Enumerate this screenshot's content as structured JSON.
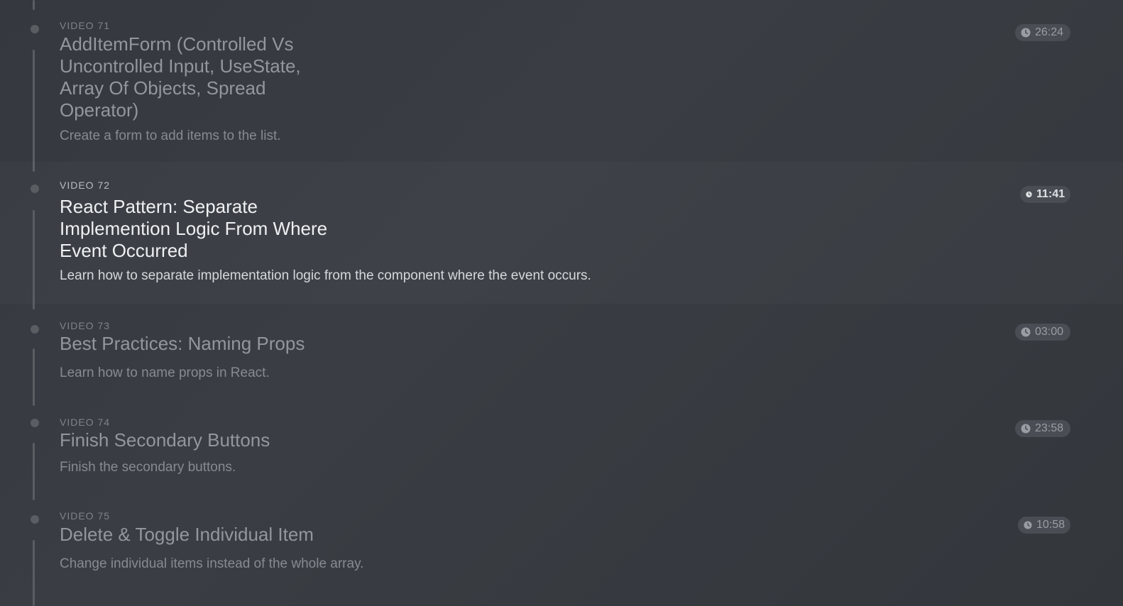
{
  "videos": [
    {
      "label": "VIDEO 71",
      "title": "AddItemForm (Controlled Vs Uncontrolled Input, UseState, Array Of Objects, Spread Operator)",
      "description": "Create a form to add items to the list.",
      "duration": "26:24",
      "active": false
    },
    {
      "label": "VIDEO 72",
      "title": "React Pattern: Separate Implemention Logic From Where Event Occurred",
      "description": "Learn how to separate implementation logic from the component where the event occurs.",
      "duration": "11:41",
      "active": true
    },
    {
      "label": "VIDEO 73",
      "title": "Best Practices: Naming Props",
      "description": "Learn how to name props in React.",
      "duration": "03:00",
      "active": false
    },
    {
      "label": "VIDEO 74",
      "title": "Finish Secondary Buttons",
      "description": "Finish the secondary buttons.",
      "duration": "23:58",
      "active": false
    },
    {
      "label": "VIDEO 75",
      "title": "Delete & Toggle Individual Item",
      "description": "Change individual items instead of the whole array.",
      "duration": "10:58",
      "active": false
    }
  ],
  "icons": {
    "duration": "clock-icon"
  },
  "colors": {
    "timeline": "#5a5e63",
    "active_title": "#eef0f2",
    "inactive_title": "#93979c"
  }
}
